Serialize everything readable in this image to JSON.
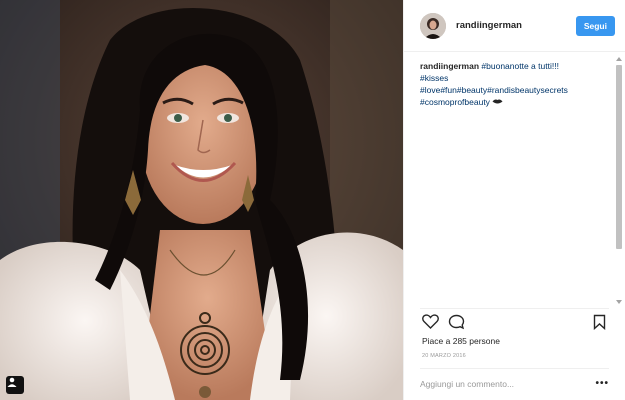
{
  "post": {
    "username": "randiingerman",
    "follow_label": "Segui",
    "caption_user": "randiingerman",
    "caption_lines": [
      "#buonanotte a tutti!!!",
      "#kisses",
      "#love#fun#beauty#randisbeautysecrets",
      "#cosmoprofbeauty"
    ],
    "caption_emoji": "lips-emoji",
    "likes_text": "Piace a 285 persone",
    "date_text": "20 MARZO 2016",
    "comment_placeholder": "Aggiungi un commento...",
    "more_label": "•••"
  },
  "icons": {
    "like": "heart-icon",
    "comment": "comment-bubble-icon",
    "save": "bookmark-icon",
    "photo_badge": "user-tag-icon"
  },
  "colors": {
    "follow_button": "#3897f0",
    "hashtag": "#003569",
    "text": "#262626",
    "muted": "#999999"
  }
}
